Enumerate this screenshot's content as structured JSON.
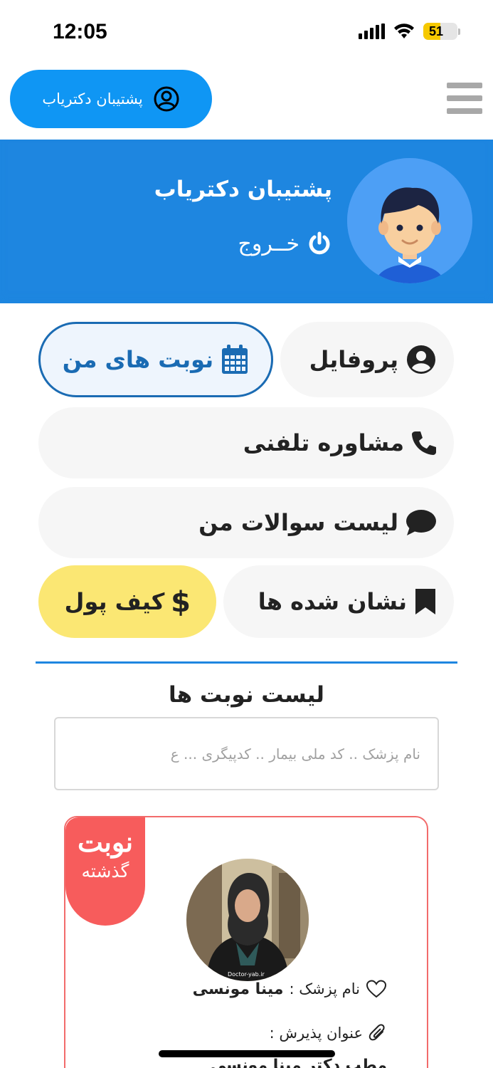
{
  "status_bar": {
    "time": "12:05",
    "battery_level": "51",
    "battery_fraction": 0.51
  },
  "top_bar": {
    "support_label": "پشتیبان دکتریاب"
  },
  "profile": {
    "name": "پشتیبان دکتریاب",
    "logout_label": "خــروج"
  },
  "menu": {
    "profile": "پروفایل",
    "appointments": "نوبت های من",
    "phone_consult": "مشاوره تلفنی",
    "questions": "لیست سوالات من",
    "bookmarks": "نشان شده ها",
    "wallet": "کیف پول"
  },
  "list": {
    "title": "لیست نوبت ها",
    "search_placeholder": "نام پزشک .. کد ملی بیمار .. کدپیگری ... ع"
  },
  "appointment": {
    "badge_line1": "نوبت",
    "badge_line2": "گذشته",
    "doctor_label": "نام پزشک :",
    "doctor_name": "مینا مونسی",
    "title_label": "عنوان پذیرش :",
    "title_value": "مطب دکتر مینا مونسی",
    "photo_watermark": "Doctor-yab.ir"
  },
  "colors": {
    "brand_blue": "#1e86e0",
    "pill_blue": "#0f96f4",
    "badge_red": "#f75c5c",
    "wallet_yellow": "#fbe773"
  }
}
